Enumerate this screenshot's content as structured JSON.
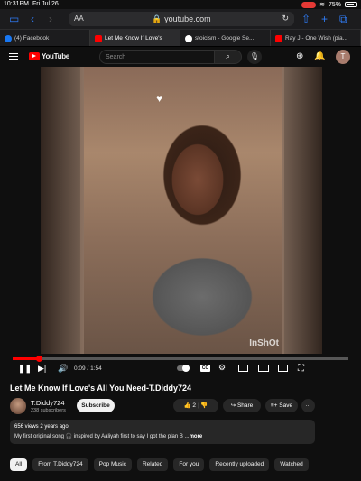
{
  "status_bar": {
    "time": "10:31PM",
    "date": "Fri Jul 26",
    "battery": "75%"
  },
  "browser": {
    "aa": "AA",
    "url": "youtube.com",
    "tabs": [
      {
        "label": "(4) Facebook",
        "color": "#1877f2"
      },
      {
        "label": "Let Me Know If Love's",
        "color": "#ff0000"
      },
      {
        "label": "stoicism - Google Se...",
        "color": "#ffffff"
      },
      {
        "label": "Ray J - One Wish (pia...",
        "color": "#ff0000"
      }
    ]
  },
  "youtube": {
    "logo_text": "YouTube",
    "search_placeholder": "Search",
    "avatar_letter": "T"
  },
  "player": {
    "watermark": "InShOt",
    "timecode": "0:09 / 1:54",
    "progress_fraction": 0.078,
    "cc_label": "CC"
  },
  "video": {
    "title": "Let Me Know If Love's All You Need-T.Diddy724",
    "channel": "T.Diddy724",
    "subscribers": "238 subscribers",
    "subscribe_label": "Subscribe",
    "likes": "2",
    "share_label": "Share",
    "save_label": "Save",
    "more_label": "···",
    "views_age": "656 views  2 years ago",
    "description": "My first original song 🎧 inspired by Aaliyah first to say I got the plan B ...",
    "more_link": "more"
  },
  "chips": [
    "All",
    "From T.Diddy724",
    "Pop Music",
    "Related",
    "For you",
    "Recently uploaded",
    "Watched"
  ]
}
